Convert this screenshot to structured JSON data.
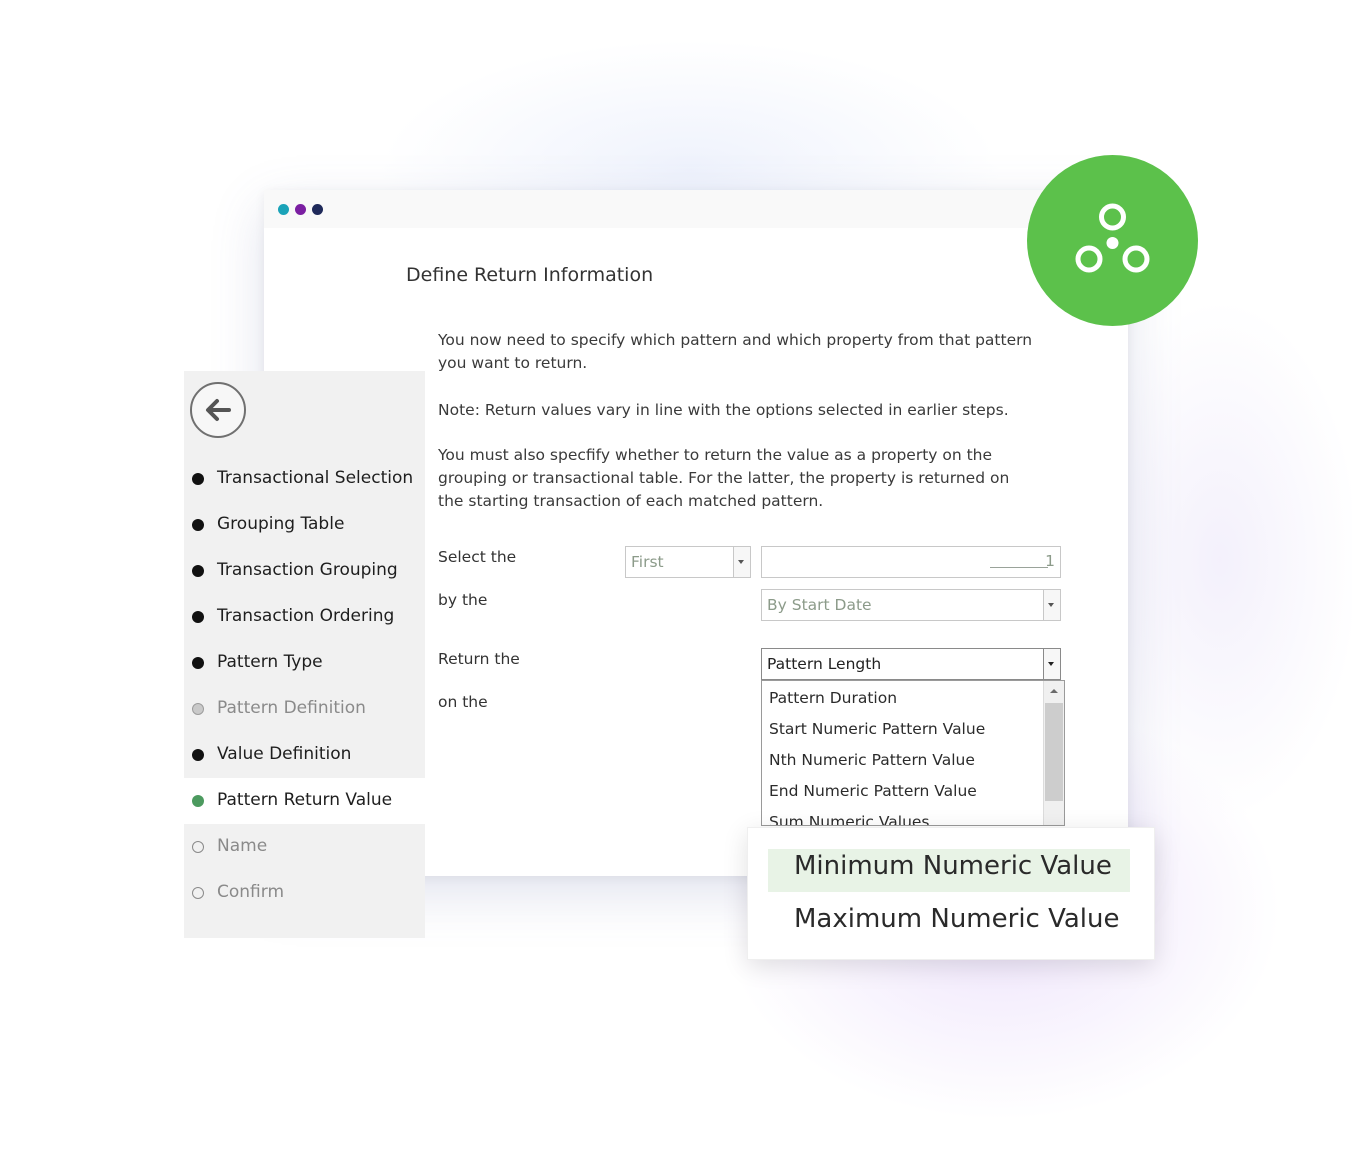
{
  "colors": {
    "accent_green": "#5cc14b",
    "active_bullet": "#4c9a5f",
    "dot_teal": "#1aa3b8",
    "dot_purple": "#7b1fa2",
    "dot_navy": "#1f2a5a",
    "zoom_highlight": "#e8f3e6"
  },
  "window": {
    "title": "Define Return Information",
    "paragraphs": [
      "You now need to specify which pattern and which property from that pattern you want to return.",
      "Note: Return values vary in line with the options selected in earlier steps.",
      "You must also specfify whether to return the value as a property on the grouping or transactional table. For the latter, the property is returned on the starting transaction of each matched pattern."
    ]
  },
  "form": {
    "select_label": "Select the",
    "select_value": "First",
    "number_value": "1",
    "by_label": "by the",
    "by_value": "By Start Date",
    "return_label": "Return the",
    "return_value": "Pattern Length",
    "on_label": "on the",
    "dropdown_options": [
      "Pattern Duration",
      "Start Numeric Pattern Value",
      "Nth Numeric Pattern Value",
      "End Numeric Pattern Value",
      "Sum Numeric Values"
    ]
  },
  "sidebar": {
    "back_icon": "arrow-left-icon",
    "steps": [
      {
        "label": "Transactional Selection",
        "state": "done"
      },
      {
        "label": "Grouping Table",
        "state": "done"
      },
      {
        "label": "Transaction Grouping",
        "state": "done"
      },
      {
        "label": "Transaction Ordering",
        "state": "done"
      },
      {
        "label": "Pattern Type",
        "state": "done"
      },
      {
        "label": "Pattern Definition",
        "state": "skipped"
      },
      {
        "label": "Value Definition",
        "state": "done"
      },
      {
        "label": "Pattern Return Value",
        "state": "current"
      },
      {
        "label": "Name",
        "state": "todo"
      },
      {
        "label": "Confirm",
        "state": "todo"
      }
    ]
  },
  "zoom": {
    "items": [
      "Minimum Numeric Value",
      "Maximum Numeric Value"
    ]
  },
  "badge": {
    "icon": "three-circles-icon"
  }
}
